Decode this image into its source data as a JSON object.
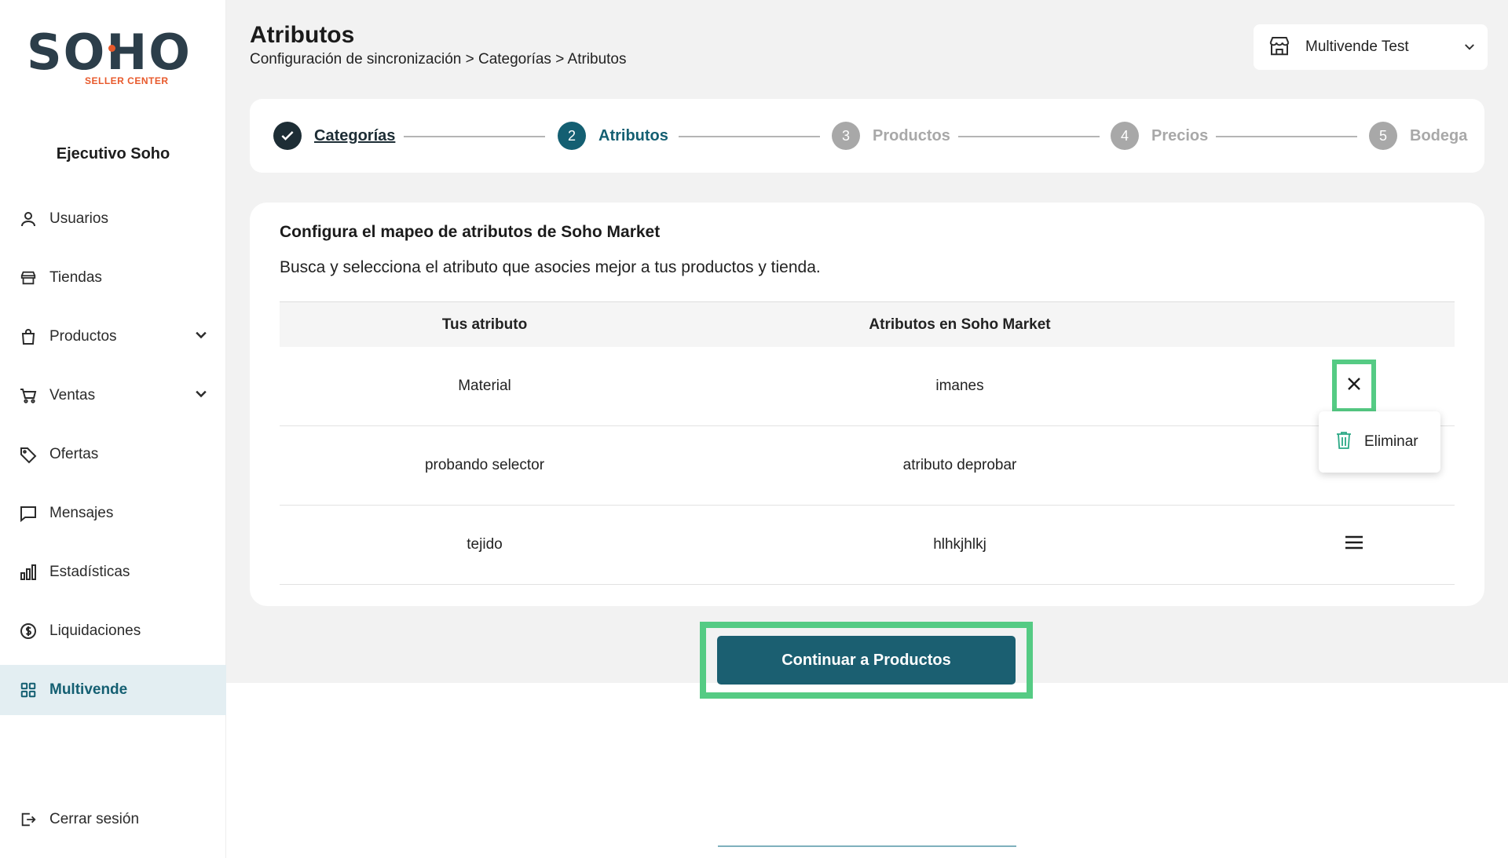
{
  "brand": {
    "logo_text": "SOHO",
    "logo_sub": "SELLER CENTER",
    "accent": "#145f72",
    "highlight": "#55cb84",
    "logo_orange": "#e8592b"
  },
  "sidebar": {
    "user_name": "Ejecutivo Soho",
    "items": [
      {
        "label": "Usuarios",
        "icon": "user-icon"
      },
      {
        "label": "Tiendas",
        "icon": "store-icon"
      },
      {
        "label": "Productos",
        "icon": "bag-icon"
      },
      {
        "label": "Ventas",
        "icon": "cart-icon"
      },
      {
        "label": "Ofertas",
        "icon": "tag-icon"
      },
      {
        "label": "Mensajes",
        "icon": "chat-icon"
      },
      {
        "label": "Estadísticas",
        "icon": "chart-icon"
      },
      {
        "label": "Liquidaciones",
        "icon": "dollar-icon"
      },
      {
        "label": "Multivende",
        "icon": "grid-icon"
      }
    ],
    "logout_label": "Cerrar sesión"
  },
  "header": {
    "title": "Atributos",
    "breadcrumb": "Configuración de sincronización > Categorías > Atributos",
    "store_selector": "Multivende Test"
  },
  "stepper": {
    "steps": [
      {
        "num": "",
        "label": "Categorías",
        "state": "done"
      },
      {
        "num": "2",
        "label": "Atributos",
        "state": "active"
      },
      {
        "num": "3",
        "label": "Productos",
        "state": "pending"
      },
      {
        "num": "4",
        "label": "Precios",
        "state": "pending"
      },
      {
        "num": "5",
        "label": "Bodega",
        "state": "pending"
      }
    ]
  },
  "card": {
    "title": "Configura el mapeo de atributos de Soho Market",
    "description": "Busca y selecciona el atributo que asocies mejor a tus productos y tienda.",
    "columns": [
      "Tus atributo",
      "Atributos en Soho Market"
    ],
    "rows": [
      {
        "own": "Material",
        "soho": "imanes"
      },
      {
        "own": "probando selector",
        "soho": "atributo deprobar"
      },
      {
        "own": "tejido",
        "soho": "hlhkjhlkj"
      }
    ],
    "menu": {
      "delete_label": "Eliminar"
    }
  },
  "cta": {
    "label": "Continuar a Productos"
  }
}
